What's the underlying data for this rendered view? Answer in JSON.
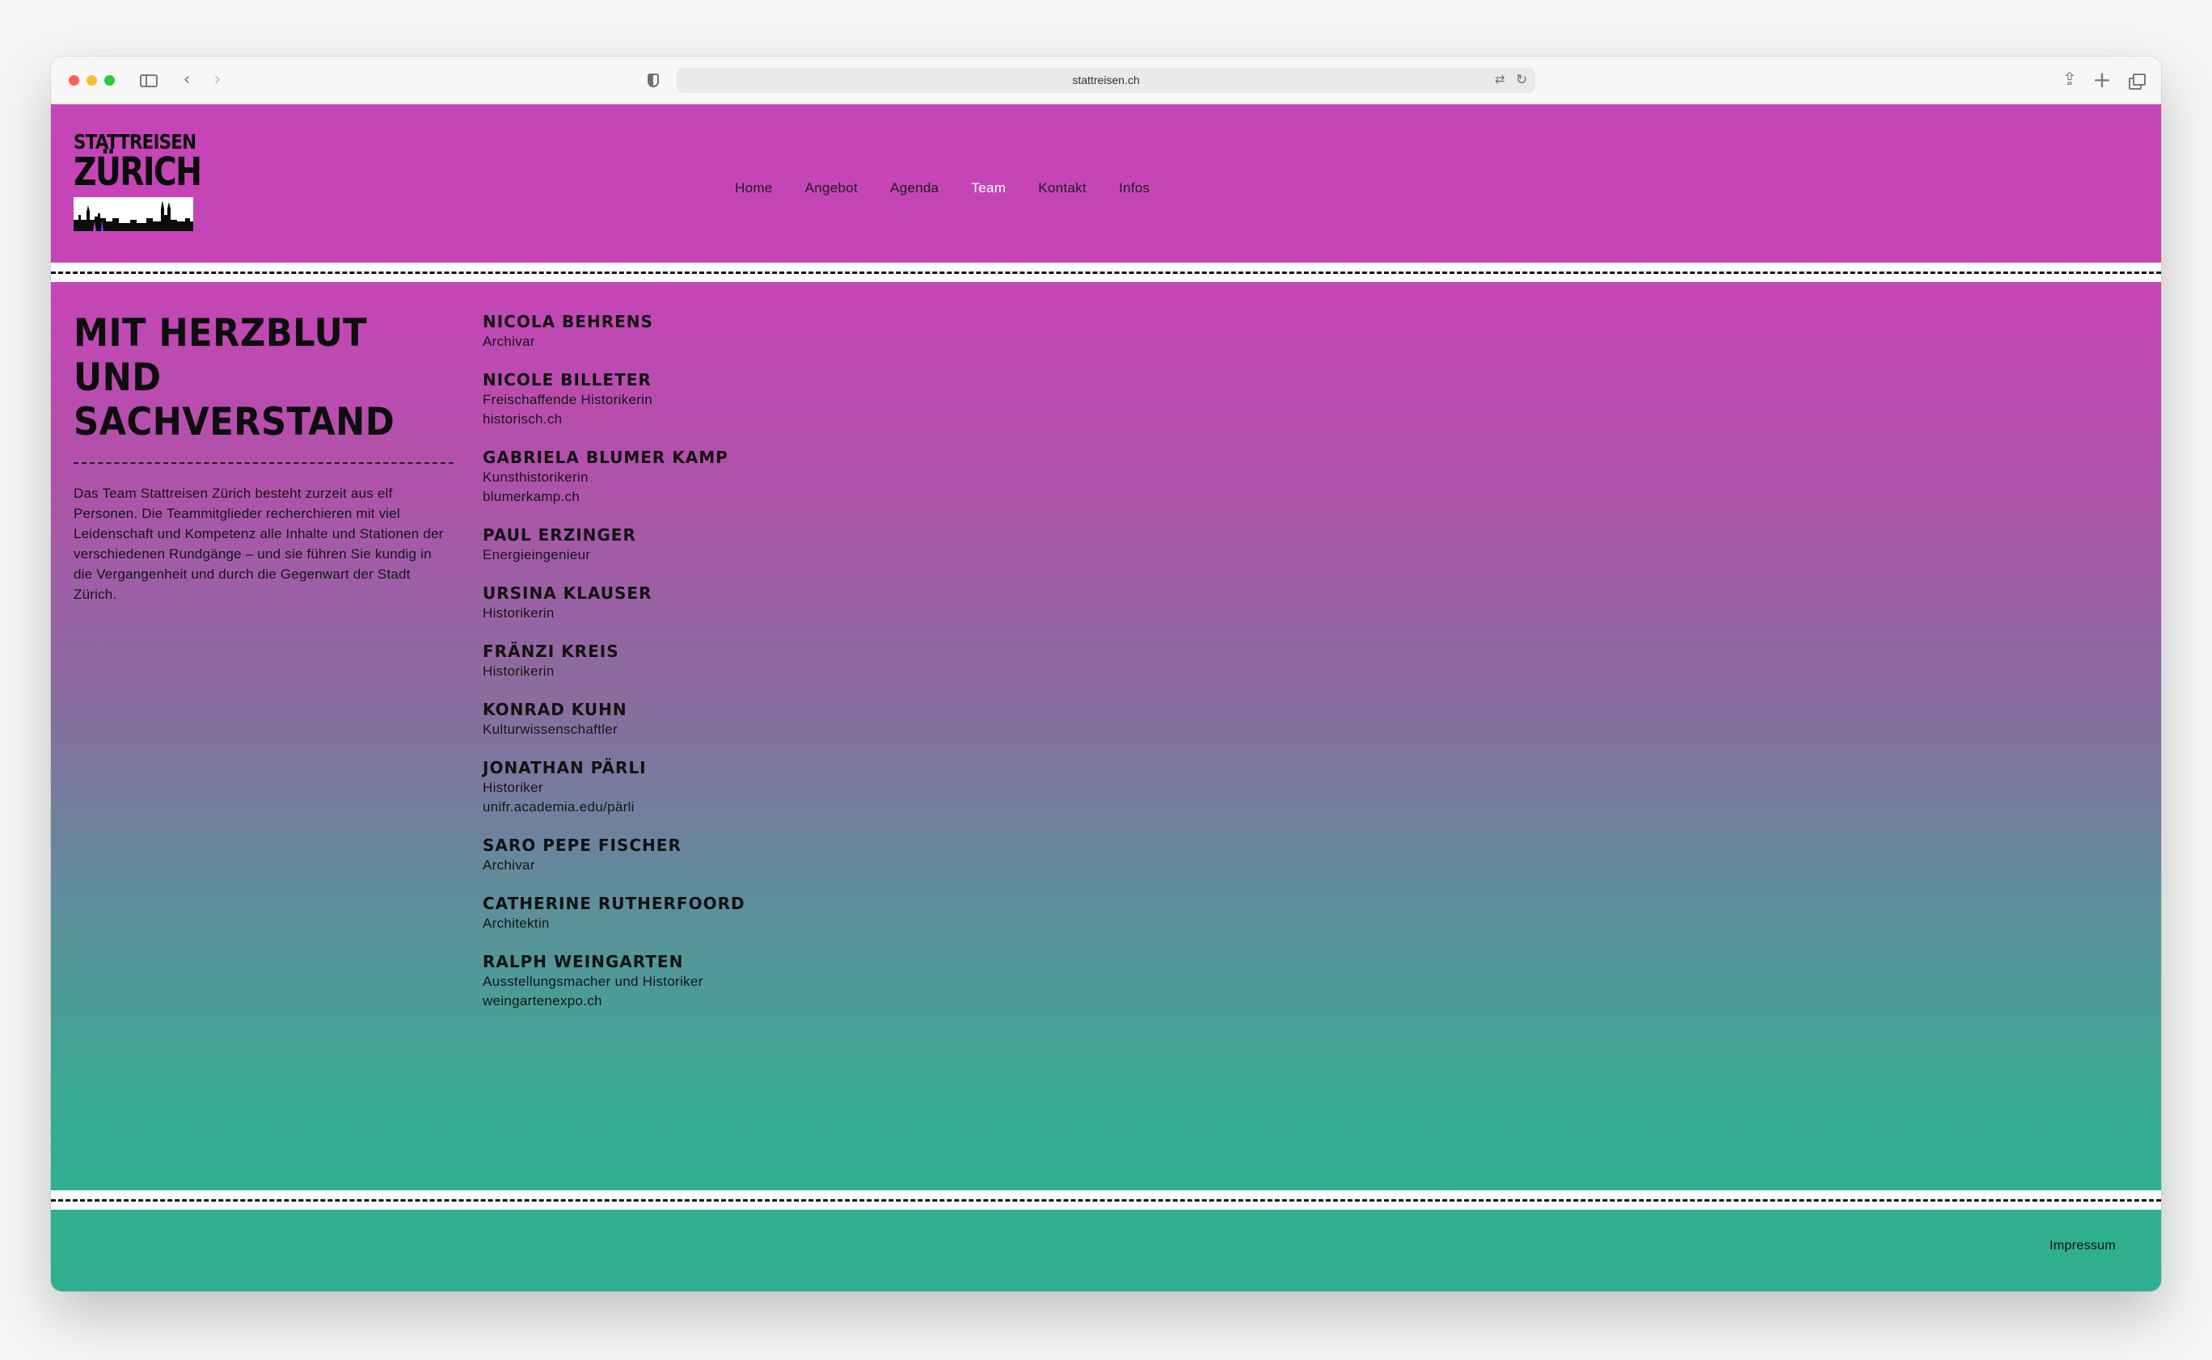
{
  "browser": {
    "url": "stattreisen.ch",
    "icons": {
      "sidebar": "sidebar-icon",
      "back": "chevron-left-icon",
      "forward": "chevron-right-icon",
      "privacy": "shield-icon",
      "translate": "translate-icon",
      "reload": "reload-icon",
      "share": "share-icon",
      "new_tab": "plus-icon",
      "tabs": "tab-overview-icon"
    }
  },
  "site": {
    "logo_line1": "STATTREISEN",
    "logo_line2": "ZÜRICH",
    "accent_colors": {
      "header": "#c645b6",
      "footer": "#2fae90"
    }
  },
  "nav": {
    "items": [
      {
        "label": "Home",
        "active": false
      },
      {
        "label": "Angebot",
        "active": false
      },
      {
        "label": "Agenda",
        "active": false
      },
      {
        "label": "Team",
        "active": true
      },
      {
        "label": "Kontakt",
        "active": false
      },
      {
        "label": "Infos",
        "active": false
      }
    ]
  },
  "intro": {
    "title_line1": "MIT HERZBLUT UND",
    "title_line2": "SACHVERSTAND",
    "text": "Das Team Stattreisen Zürich besteht zurzeit aus elf Personen. Die Teammitglieder recherchieren mit viel Leidenschaft und Kompetenz alle Inhalte und Stationen der verschiedenen Rundgänge – und sie führen Sie kundig in die Vergangenheit und durch die Gegenwart der Stadt Zürich."
  },
  "team": {
    "members": [
      {
        "name": "NICOLA BEHRENS",
        "role": "Archivar",
        "link": ""
      },
      {
        "name": "NICOLE BILLETER",
        "role": "Freischaffende Historikerin",
        "link": "historisch.ch"
      },
      {
        "name": "GABRIELA BLUMER KAMP",
        "role": "Kunsthistorikerin",
        "link": "blumerkamp.ch"
      },
      {
        "name": "PAUL ERZINGER",
        "role": "Energieingenieur",
        "link": ""
      },
      {
        "name": "URSINA KLAUSER",
        "role": "Historikerin",
        "link": ""
      },
      {
        "name": "FRÄNZI KREIS",
        "role": "Historikerin",
        "link": ""
      },
      {
        "name": "KONRAD KUHN",
        "role": "Kulturwissenschaftler",
        "link": ""
      },
      {
        "name": "JONATHAN PÄRLI",
        "role": "Historiker",
        "link": "unifr.academia.edu/pärli"
      },
      {
        "name": "SARO PEPE FISCHER",
        "role": "Archivar",
        "link": ""
      },
      {
        "name": "CATHERINE RUTHERFOORD",
        "role": "Architektin",
        "link": ""
      },
      {
        "name": "RALPH WEINGARTEN",
        "role": "Ausstellungsmacher und Historiker",
        "link": "weingartenexpo.ch"
      }
    ]
  },
  "footer": {
    "impressum": "Impressum"
  }
}
